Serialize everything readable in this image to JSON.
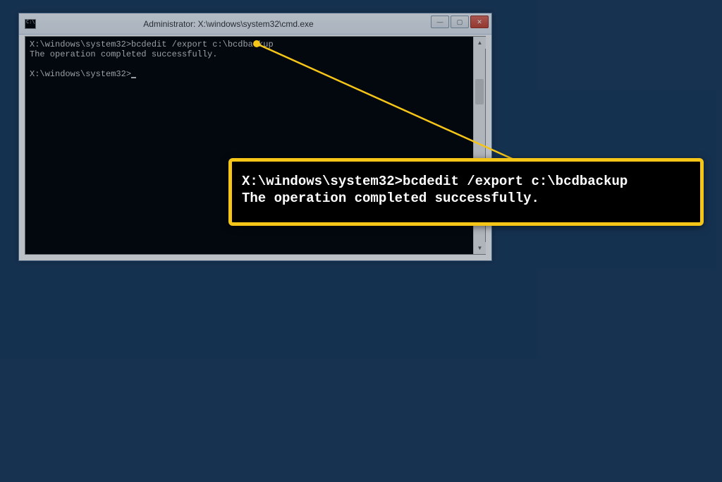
{
  "window": {
    "sysmenu_glyph": "C:\\",
    "title": "Administrator: X:\\windows\\system32\\cmd.exe",
    "controls": {
      "minimize": "—",
      "maximize": "▢",
      "close": "✕"
    }
  },
  "terminal": {
    "line1": "X:\\windows\\system32>bcdedit /export c:\\bcdbackup",
    "line2": "The operation completed successfully.",
    "blank": "",
    "prompt": "X:\\windows\\system32>",
    "scroll_up": "▲",
    "scroll_down": "▼"
  },
  "callout": {
    "line1": "X:\\windows\\system32>bcdedit /export c:\\bcdbackup",
    "line2": "The operation completed successfully."
  },
  "colors": {
    "background": "#1a3a5c",
    "highlight": "#f5c518",
    "terminal_bg": "#000000",
    "terminal_text": "#d0d0d0",
    "callout_text": "#ffffff"
  }
}
